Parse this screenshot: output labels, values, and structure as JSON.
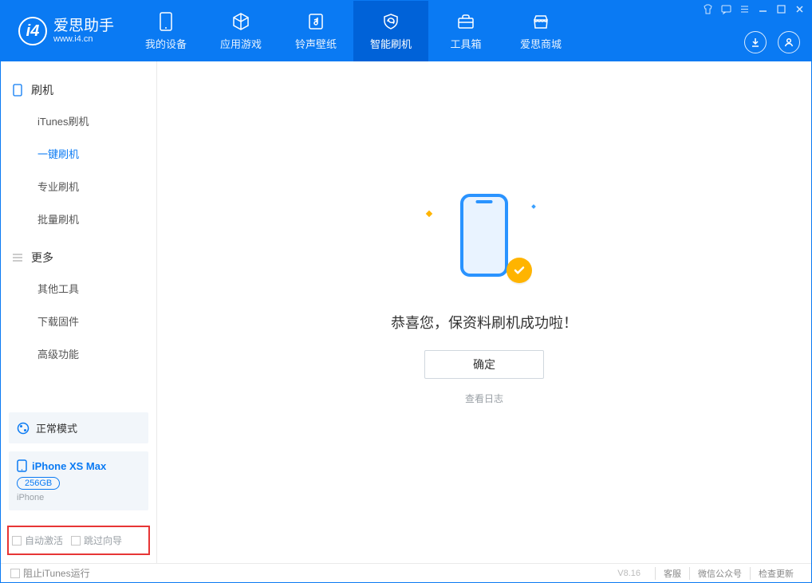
{
  "app": {
    "name": "爱思助手",
    "url": "www.i4.cn"
  },
  "nav": {
    "items": [
      {
        "label": "我的设备"
      },
      {
        "label": "应用游戏"
      },
      {
        "label": "铃声壁纸"
      },
      {
        "label": "智能刷机"
      },
      {
        "label": "工具箱"
      },
      {
        "label": "爱思商城"
      }
    ]
  },
  "sidebar": {
    "section1": {
      "title": "刷机",
      "items": [
        "iTunes刷机",
        "一键刷机",
        "专业刷机",
        "批量刷机"
      ]
    },
    "section2": {
      "title": "更多",
      "items": [
        "其他工具",
        "下载固件",
        "高级功能"
      ]
    },
    "mode": "正常模式",
    "device": {
      "name": "iPhone XS Max",
      "storage": "256GB",
      "type": "iPhone"
    },
    "checks": {
      "auto_activate": "自动激活",
      "skip_guide": "跳过向导"
    }
  },
  "main": {
    "success_text": "恭喜您，保资料刷机成功啦！",
    "ok_button": "确定",
    "view_log": "查看日志"
  },
  "footer": {
    "block_itunes": "阻止iTunes运行",
    "version": "V8.16",
    "links": {
      "support": "客服",
      "wechat": "微信公众号",
      "update": "检查更新"
    }
  }
}
